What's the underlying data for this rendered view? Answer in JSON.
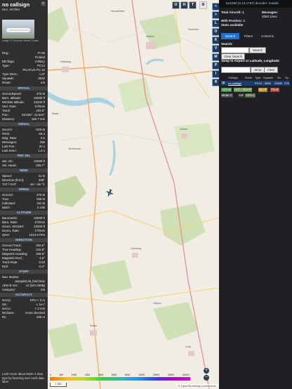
{
  "left": {
    "callsign": "no callsign",
    "hex": "Hex: 467894",
    "close": "×",
    "photo_credit": "Image © Florencio Martin Rodan",
    "reg_rows": [
      {
        "k": "Reg.:",
        "v": "FI-05"
      },
      {
        "k": "",
        "v": "Finland"
      },
      {
        "k": "DB flags:",
        "v": "military"
      },
      {
        "k": "Type:",
        "v": "PC12"
      },
      {
        "k": "",
        "v": "PILATUS PC-12"
      },
      {
        "k": "Type Desc.:",
        "v": "L1T"
      },
      {
        "k": "Squawk:",
        "v": "3522"
      },
      {
        "k": "Route:",
        "v": "n/a"
      }
    ],
    "sections": [
      {
        "title": "SPATIAL",
        "rows": [
          {
            "k": "Groundspeed:",
            "v": "275 kt"
          },
          {
            "k": "Baro. altitude:",
            "v": "22000 ft"
          },
          {
            "k": "WGS84 altitude:",
            "v": "22200 ft"
          },
          {
            "k": "Vert. Rate:",
            "v": "0 ft/min"
          },
          {
            "k": "Track:",
            "v": "202.0°"
          },
          {
            "k": "Pos.:",
            "v": "53.625°, 10.524°"
          },
          {
            "k": "Distance:",
            "v": "166.7 nmi"
          }
        ]
      },
      {
        "title": "SIGNAL",
        "rows": [
          {
            "k": "Source:",
            "v": "ADS-B"
          },
          {
            "k": "RSSI:",
            "v": "-26.4"
          },
          {
            "k": "Msg. Rate:",
            "v": "0.5"
          },
          {
            "k": "Messages:",
            "v": "259"
          },
          {
            "k": "Last Pos.:",
            "v": "22 s"
          },
          {
            "k": "Last Seen:",
            "v": "1.6 s"
          }
        ]
      },
      {
        "title": "FMS SEL",
        "rows": [
          {
            "k": "Sel. Alt.:",
            "v": "22000 ft"
          },
          {
            "k": "Sel. Head.:",
            "v": "206.7°"
          }
        ]
      },
      {
        "title": "WIND",
        "rows": [
          {
            "k": "Speed:",
            "v": "41 kt"
          },
          {
            "k": "Direction (from):",
            "v": "308°"
          },
          {
            "k": "TAT / OAT:",
            "v": "-19 / -29 °C"
          }
        ]
      },
      {
        "title": "SPEED",
        "rows": [
          {
            "k": "Ground:",
            "v": "275 kt"
          },
          {
            "k": "True:",
            "v": "268 kt"
          },
          {
            "k": "Indicated:",
            "v": "191 kt"
          },
          {
            "k": "Mach:",
            "v": "0.436"
          }
        ]
      },
      {
        "title": "ALTITUDE",
        "rows": [
          {
            "k": "Barometric:",
            "v": "22000 ft"
          },
          {
            "k": "Baro. Rate:",
            "v": "0 ft/min"
          },
          {
            "k": "Geom. WGS84:",
            "v": "22200 ft"
          },
          {
            "k": "Geom. Rate:",
            "v": "0 ft/min"
          },
          {
            "k": "QNH:",
            "v": "1013.6 hPa"
          }
        ]
      },
      {
        "title": "DIRECTION",
        "rows": [
          {
            "k": "Ground Track:",
            "v": "202.0°"
          },
          {
            "k": "True Heading:",
            "v": "210.9°"
          },
          {
            "k": "Magnetic Heading:",
            "v": "206.5°"
          },
          {
            "k": "Magnetic Decl.:",
            "v": "4.5°"
          },
          {
            "k": "Track Rate:",
            "v": "0.03"
          },
          {
            "k": "Roll:",
            "v": "-0.4°"
          }
        ]
      },
      {
        "title": "STUFF",
        "rows": [
          {
            "k": "Nav. Modes:",
            "v": ""
          },
          {
            "k": "",
            "v": "autopilot,alt_hold,lnav"
          },
          {
            "k": "ADS-B Ver.:",
            "v": "v2 (DO-260B)"
          },
          {
            "k": "Category:",
            "v": "n/a"
          }
        ]
      },
      {
        "title": "ACCURACY",
        "rows": [
          {
            "k": "NACp:",
            "v": "EPU < 3 m"
          },
          {
            "k": "SIL:",
            "v": "≤ 1e-7"
          },
          {
            "k": "NACv:",
            "v": "< 3 m/s"
          },
          {
            "k": "NICbaro:",
            "v": "cross-checked"
          },
          {
            "k": "Rc:",
            "v": "186 m"
          }
        ]
      }
    ],
    "learn_more": "Learn more about Mode S data type by hovering over each data label"
  },
  "map": {
    "top_buttons": [
      "U",
      "H",
      "T"
    ],
    "cities": [
      "Lübeck",
      "Hamburg",
      "Lüneburg",
      "Schwerin",
      "Stade",
      "Buxtehude",
      "Uelzen",
      "Soltau",
      "Celle",
      "Gifhorn",
      "Neumünster"
    ],
    "altitude_labels": [
      "0",
      "500",
      "1000",
      "2000",
      "4000",
      "6000",
      "8000",
      "10000",
      "20000",
      "30000",
      "40000+"
    ],
    "scale": "1 NM",
    "attribution": "© OpenStreetMap contributors",
    "zoom_in": "+",
    "zoom_out": "−"
  },
  "vbar": {
    "buttons": [
      "<",
      ">",
      "L",
      "O",
      "K",
      "V",
      "M",
      "P",
      "I",
      "R"
    ]
  },
  "right": {
    "version_line": "tar1090 (3.14.1767) decoder: readsb",
    "stats": {
      "total_aircraft": "Total Aircraft: 1",
      "messages": "Messages:",
      "msg_rate": "2050.1/sec",
      "with_position": "With Position: 1",
      "stats_available": "Stats available"
    },
    "tabs": [
      "Search",
      "Filters",
      "Columns"
    ],
    "search": {
      "label": "Search:",
      "button": "Search",
      "clear_button": "Clear Search",
      "jump_label": "Jump to Airport or Latitude, Longitude:",
      "jump_button": "Jump",
      "clear": "Clear"
    },
    "table": {
      "headers": [
        "Callsign",
        "Route",
        "Type",
        "Squawk",
        "Alt.",
        "Sp."
      ],
      "row": [
        "no callsign",
        "",
        "PC12",
        "3522",
        "22000",
        "275"
      ]
    },
    "chips": [
      "ADS-B",
      "UAT / ADS-R",
      "MLAT",
      "TIS-B",
      "Mode-S",
      "AIS",
      "ADS-C"
    ]
  },
  "colors": {
    "map_land": "#f1ede4",
    "forest": "#c8dcb0",
    "panel": "#2f2f2f",
    "accent": "#1b74d1",
    "aircraft": "#2a6bb0"
  }
}
